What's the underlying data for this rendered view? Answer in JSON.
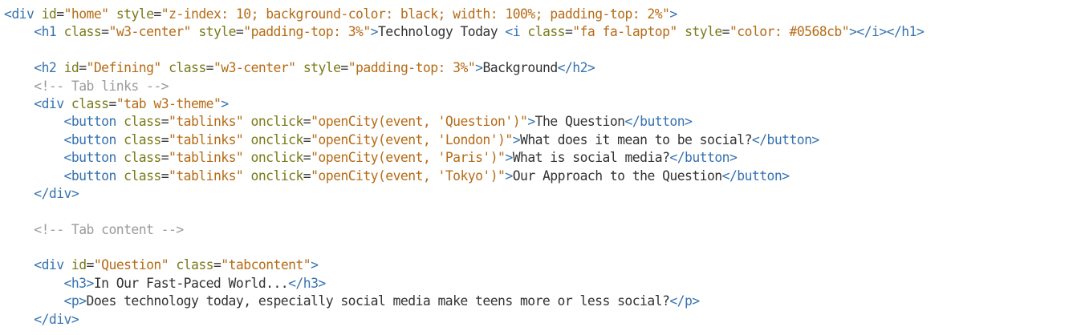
{
  "lines": [
    {
      "indent": 0,
      "tokens": [
        {
          "k": "t",
          "v": "<div"
        },
        {
          "k": "x",
          "v": " "
        },
        {
          "k": "a",
          "v": "id"
        },
        {
          "k": "p",
          "v": "="
        },
        {
          "k": "s",
          "v": "\"home\""
        },
        {
          "k": "x",
          "v": " "
        },
        {
          "k": "a",
          "v": "style"
        },
        {
          "k": "p",
          "v": "="
        },
        {
          "k": "s",
          "v": "\"z-index: 10; background-color: black; width: 100%; padding-top: 2%\""
        },
        {
          "k": "t",
          "v": ">"
        }
      ]
    },
    {
      "indent": 4,
      "tokens": [
        {
          "k": "t",
          "v": "<h1"
        },
        {
          "k": "x",
          "v": " "
        },
        {
          "k": "a",
          "v": "class"
        },
        {
          "k": "p",
          "v": "="
        },
        {
          "k": "s",
          "v": "\"w3-center\""
        },
        {
          "k": "x",
          "v": " "
        },
        {
          "k": "a",
          "v": "style"
        },
        {
          "k": "p",
          "v": "="
        },
        {
          "k": "s",
          "v": "\"padding-top: 3%\""
        },
        {
          "k": "t",
          "v": ">"
        },
        {
          "k": "x",
          "v": "Technology Today "
        },
        {
          "k": "t",
          "v": "<i"
        },
        {
          "k": "x",
          "v": " "
        },
        {
          "k": "a",
          "v": "class"
        },
        {
          "k": "p",
          "v": "="
        },
        {
          "k": "s",
          "v": "\"fa fa-laptop\""
        },
        {
          "k": "x",
          "v": " "
        },
        {
          "k": "a",
          "v": "style"
        },
        {
          "k": "p",
          "v": "="
        },
        {
          "k": "s",
          "v": "\"color: #0568cb\""
        },
        {
          "k": "t",
          "v": "></i></h1>"
        }
      ]
    },
    {
      "indent": 0,
      "tokens": []
    },
    {
      "indent": 4,
      "tokens": [
        {
          "k": "t",
          "v": "<h2"
        },
        {
          "k": "x",
          "v": " "
        },
        {
          "k": "a",
          "v": "id"
        },
        {
          "k": "p",
          "v": "="
        },
        {
          "k": "s",
          "v": "\"Defining\""
        },
        {
          "k": "x",
          "v": " "
        },
        {
          "k": "a",
          "v": "class"
        },
        {
          "k": "p",
          "v": "="
        },
        {
          "k": "s",
          "v": "\"w3-center\""
        },
        {
          "k": "x",
          "v": " "
        },
        {
          "k": "a",
          "v": "style"
        },
        {
          "k": "p",
          "v": "="
        },
        {
          "k": "s",
          "v": "\"padding-top: 3%\""
        },
        {
          "k": "t",
          "v": ">"
        },
        {
          "k": "x",
          "v": "Background"
        },
        {
          "k": "t",
          "v": "</h2>"
        }
      ]
    },
    {
      "indent": 4,
      "tokens": [
        {
          "k": "c",
          "v": "<!-- Tab links -->"
        }
      ]
    },
    {
      "indent": 4,
      "tokens": [
        {
          "k": "t",
          "v": "<div"
        },
        {
          "k": "x",
          "v": " "
        },
        {
          "k": "a",
          "v": "class"
        },
        {
          "k": "p",
          "v": "="
        },
        {
          "k": "s",
          "v": "\"tab w3-theme\""
        },
        {
          "k": "t",
          "v": ">"
        }
      ]
    },
    {
      "indent": 8,
      "tokens": [
        {
          "k": "t",
          "v": "<button"
        },
        {
          "k": "x",
          "v": " "
        },
        {
          "k": "a",
          "v": "class"
        },
        {
          "k": "p",
          "v": "="
        },
        {
          "k": "s",
          "v": "\"tablinks\""
        },
        {
          "k": "x",
          "v": " "
        },
        {
          "k": "a",
          "v": "onclick"
        },
        {
          "k": "p",
          "v": "="
        },
        {
          "k": "s",
          "v": "\"openCity(event, 'Question')\""
        },
        {
          "k": "t",
          "v": ">"
        },
        {
          "k": "x",
          "v": "The Question"
        },
        {
          "k": "t",
          "v": "</button>"
        }
      ]
    },
    {
      "indent": 8,
      "tokens": [
        {
          "k": "t",
          "v": "<button"
        },
        {
          "k": "x",
          "v": " "
        },
        {
          "k": "a",
          "v": "class"
        },
        {
          "k": "p",
          "v": "="
        },
        {
          "k": "s",
          "v": "\"tablinks\""
        },
        {
          "k": "x",
          "v": " "
        },
        {
          "k": "a",
          "v": "onclick"
        },
        {
          "k": "p",
          "v": "="
        },
        {
          "k": "s",
          "v": "\"openCity(event, 'London')\""
        },
        {
          "k": "t",
          "v": ">"
        },
        {
          "k": "x",
          "v": "What does it mean to be social?"
        },
        {
          "k": "t",
          "v": "</button>"
        }
      ]
    },
    {
      "indent": 8,
      "tokens": [
        {
          "k": "t",
          "v": "<button"
        },
        {
          "k": "x",
          "v": " "
        },
        {
          "k": "a",
          "v": "class"
        },
        {
          "k": "p",
          "v": "="
        },
        {
          "k": "s",
          "v": "\"tablinks\""
        },
        {
          "k": "x",
          "v": " "
        },
        {
          "k": "a",
          "v": "onclick"
        },
        {
          "k": "p",
          "v": "="
        },
        {
          "k": "s",
          "v": "\"openCity(event, 'Paris')\""
        },
        {
          "k": "t",
          "v": ">"
        },
        {
          "k": "x",
          "v": "What is social media?"
        },
        {
          "k": "t",
          "v": "</button>"
        }
      ]
    },
    {
      "indent": 8,
      "tokens": [
        {
          "k": "t",
          "v": "<button"
        },
        {
          "k": "x",
          "v": " "
        },
        {
          "k": "a",
          "v": "class"
        },
        {
          "k": "p",
          "v": "="
        },
        {
          "k": "s",
          "v": "\"tablinks\""
        },
        {
          "k": "x",
          "v": " "
        },
        {
          "k": "a",
          "v": "onclick"
        },
        {
          "k": "p",
          "v": "="
        },
        {
          "k": "s",
          "v": "\"openCity(event, 'Tokyo')\""
        },
        {
          "k": "t",
          "v": ">"
        },
        {
          "k": "x",
          "v": "Our Approach to the Question"
        },
        {
          "k": "t",
          "v": "</button>"
        }
      ]
    },
    {
      "indent": 4,
      "tokens": [
        {
          "k": "t",
          "v": "</div>"
        }
      ]
    },
    {
      "indent": 0,
      "tokens": []
    },
    {
      "indent": 4,
      "tokens": [
        {
          "k": "c",
          "v": "<!-- Tab content -->"
        }
      ]
    },
    {
      "indent": 0,
      "tokens": []
    },
    {
      "indent": 4,
      "tokens": [
        {
          "k": "t",
          "v": "<div"
        },
        {
          "k": "x",
          "v": " "
        },
        {
          "k": "a",
          "v": "id"
        },
        {
          "k": "p",
          "v": "="
        },
        {
          "k": "s",
          "v": "\"Question\""
        },
        {
          "k": "x",
          "v": " "
        },
        {
          "k": "a",
          "v": "class"
        },
        {
          "k": "p",
          "v": "="
        },
        {
          "k": "s",
          "v": "\"tabcontent\""
        },
        {
          "k": "t",
          "v": ">"
        }
      ]
    },
    {
      "indent": 8,
      "tokens": [
        {
          "k": "t",
          "v": "<h3>"
        },
        {
          "k": "x",
          "v": "In Our Fast-Paced World..."
        },
        {
          "k": "t",
          "v": "</h3>"
        }
      ]
    },
    {
      "indent": 8,
      "tokens": [
        {
          "k": "t",
          "v": "<p>"
        },
        {
          "k": "x",
          "v": "Does technology today, especially social media make teens more or less social?"
        },
        {
          "k": "t",
          "v": "</p>"
        }
      ]
    },
    {
      "indent": 4,
      "tokens": [
        {
          "k": "t",
          "v": "</div>"
        }
      ]
    }
  ],
  "colors": {
    "background": "#ffffff",
    "tag": "#3572b0",
    "attribute": "#7a7a1a",
    "string": "#b66b16",
    "text": "#333333",
    "comment": "#9a9a9a"
  }
}
